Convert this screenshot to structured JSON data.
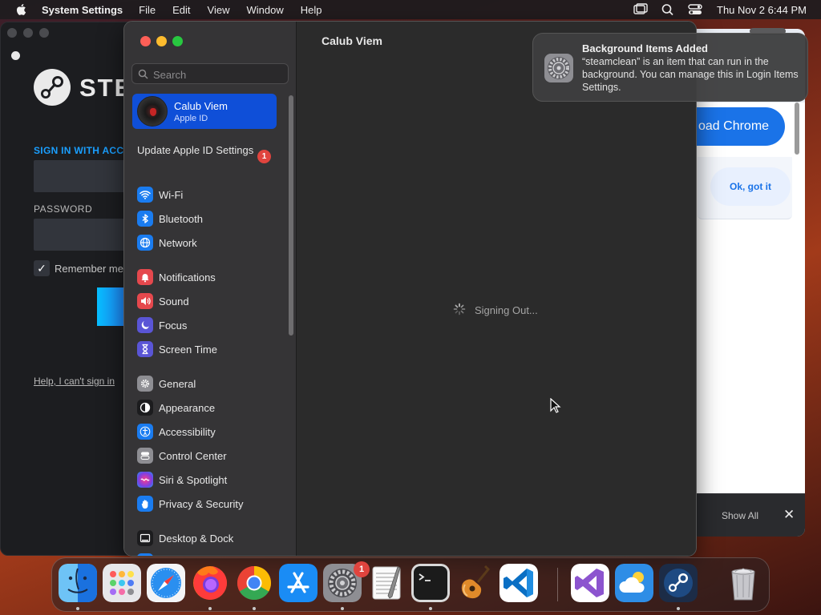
{
  "menubar": {
    "app_name": "System Settings",
    "menus": [
      "File",
      "Edit",
      "View",
      "Window",
      "Help"
    ],
    "clock": "Thu Nov 2  6:44 PM"
  },
  "steam": {
    "word": "STEA",
    "sign_in": "SIGN IN WITH ACCO",
    "password": "PASSWORD",
    "remember": "Remember me",
    "help": "Help, I can't sign in"
  },
  "chrome": {
    "download_button": "oad Chrome",
    "ok_button": "Ok, got it",
    "show_all": "Show All",
    "close": "✕"
  },
  "settings": {
    "search_placeholder": "Search",
    "account": {
      "name": "Calub Viem",
      "subtitle": "Apple ID"
    },
    "update": {
      "label": "Update Apple ID Settings",
      "badge": "1"
    },
    "nav": [
      {
        "label": "Wi-Fi",
        "icon": "wifi-icon",
        "color": "#1a7cf0"
      },
      {
        "label": "Bluetooth",
        "icon": "bluetooth-icon",
        "color": "#1a7cf0"
      },
      {
        "label": "Network",
        "icon": "globe-icon",
        "color": "#1a7cf0"
      },
      {
        "label": "Notifications",
        "icon": "bell-icon",
        "color": "#e5484d"
      },
      {
        "label": "Sound",
        "icon": "speaker-icon",
        "color": "#e5484d"
      },
      {
        "label": "Focus",
        "icon": "moon-icon",
        "color": "#5a55d6"
      },
      {
        "label": "Screen Time",
        "icon": "hourglass-icon",
        "color": "#5a55d6"
      },
      {
        "label": "General",
        "icon": "gear-icon",
        "color": "#8e8e93"
      },
      {
        "label": "Appearance",
        "icon": "appearance-icon",
        "color": "#1c1c1e"
      },
      {
        "label": "Accessibility",
        "icon": "accessibility-icon",
        "color": "#1a7cf0"
      },
      {
        "label": "Control Center",
        "icon": "control-center-icon",
        "color": "#8e8e93"
      },
      {
        "label": "Siri & Spotlight",
        "icon": "siri-icon",
        "color": "#7b3fe4"
      },
      {
        "label": "Privacy & Security",
        "icon": "hand-icon",
        "color": "#1a7cf0"
      },
      {
        "label": "Desktop & Dock",
        "icon": "dock-icon",
        "color": "#1c1c1e"
      }
    ],
    "content_title": "Calub Viem",
    "status": "Signing Out..."
  },
  "notification": {
    "title": "Background Items Added",
    "body": "“steamclean” is an item that can run in the background. You can manage this in Login Items Settings."
  },
  "dock": {
    "items": [
      "Finder",
      "Launchpad",
      "Safari",
      "Firefox",
      "Google Chrome",
      "App Store",
      "System Settings",
      "TextEdit",
      "Terminal",
      "GarageBand",
      "Visual Studio Code",
      "Visual Studio",
      "Weather",
      "Steam",
      "Trash"
    ],
    "settings_badge": "1"
  }
}
